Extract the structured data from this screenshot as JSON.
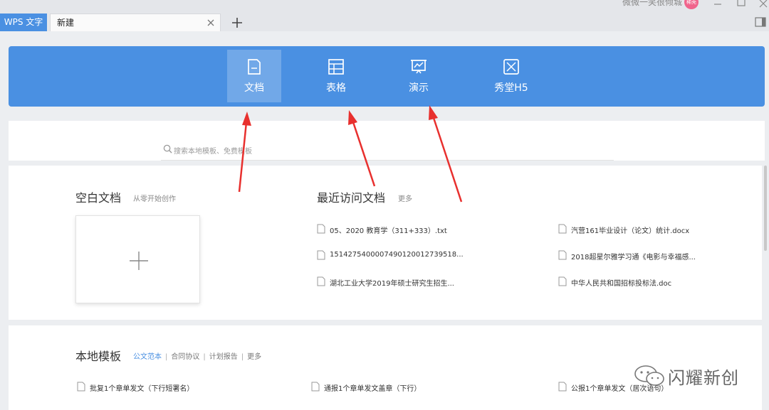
{
  "titlebar": {
    "app_tab": "WPS 文字",
    "new_tab": "新建",
    "user_name": "微微一笑很倾城",
    "user_badge": "稀壳"
  },
  "nav": {
    "items": [
      {
        "label": "文档",
        "icon": "document-icon",
        "active": true
      },
      {
        "label": "表格",
        "icon": "spreadsheet-icon",
        "active": false
      },
      {
        "label": "演示",
        "icon": "presentation-icon",
        "active": false
      },
      {
        "label": "秀堂H5",
        "icon": "h5-icon",
        "active": false
      }
    ]
  },
  "search": {
    "placeholder": "搜索本地模板、免费模板"
  },
  "blank": {
    "title": "空白文档",
    "subtitle": "从零开始创作"
  },
  "recent": {
    "title": "最近访问文档",
    "more": "更多",
    "files": [
      "05、2020 教育学（311+333）.txt",
      "汽营161毕业设计（论文）统计.docx",
      "1514275400007490120012739518...",
      "2018超星尔雅学习通《电影与幸福感...",
      "湖北工业大学2019年硕士研究生招生...",
      "中华人民共和国招标投标法.doc"
    ]
  },
  "local_templates": {
    "title": "本地模板",
    "tabs": [
      {
        "label": "公文范本",
        "active": true
      },
      {
        "label": "合同协议",
        "active": false
      },
      {
        "label": "计划报告",
        "active": false
      },
      {
        "label": "更多",
        "active": false
      }
    ],
    "items": [
      "批复1个章单发文（下行短署名）",
      "通报1个章单发文盖章（下行）",
      "公报1个章单发文（居次语句）"
    ]
  },
  "watermark": {
    "text": "闪耀新创"
  },
  "colors": {
    "accent": "#4a90e2",
    "arrow": "#e8302e",
    "badge": "#f0648c"
  }
}
